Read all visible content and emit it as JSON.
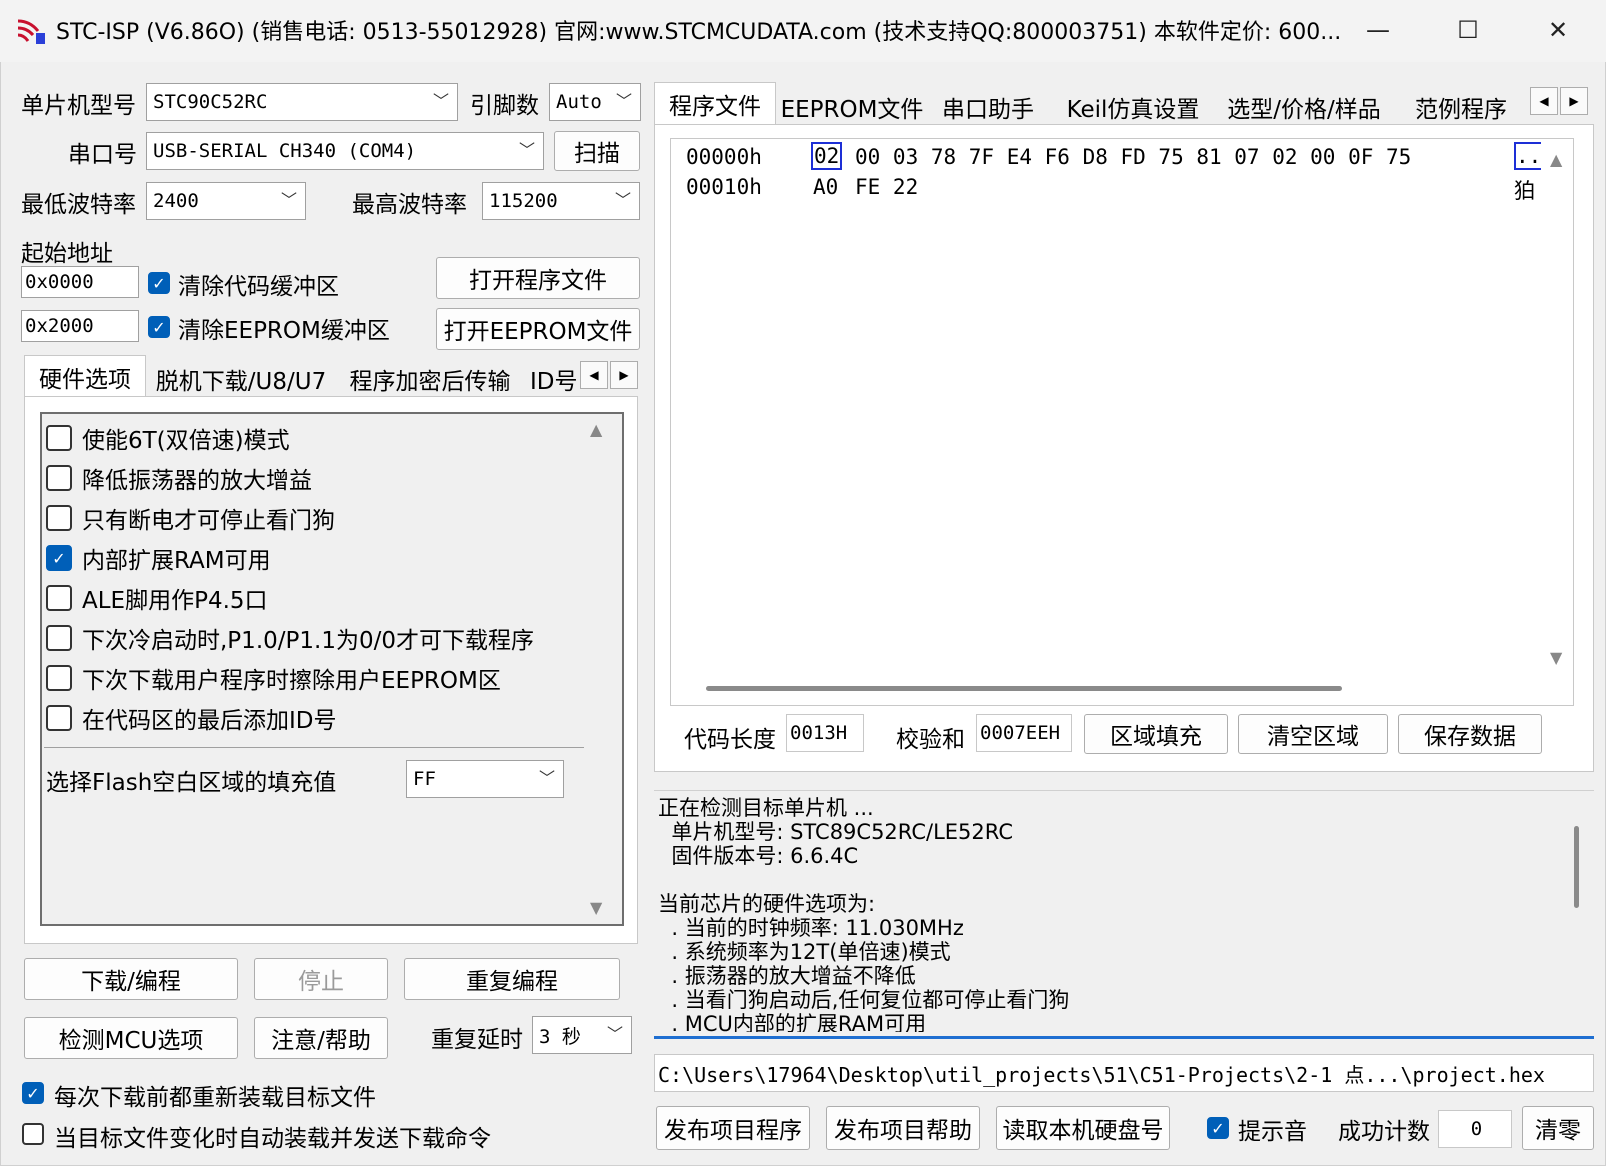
{
  "window": {
    "title": "STC-ISP (V6.86O) (销售电话: 0513-55012928) 官网:www.STCMCUDATA.com  (技术支持QQ:800003751) 本软件定价: 600...",
    "minimize": "—",
    "maximize": "☐",
    "close": "✕"
  },
  "mcu": {
    "model_label": "单片机型号",
    "model_value": "STC90C52RC",
    "pins_label": "引脚数",
    "pins_value": "Auto",
    "port_label": "串口号",
    "port_value": "USB-SERIAL CH340  (COM4)",
    "scan_label": "扫描",
    "min_baud_label": "最低波特率",
    "min_baud_value": "2400",
    "max_baud_label": "最高波特率",
    "max_baud_value": "115200"
  },
  "start_address": {
    "label": "起始地址",
    "code_addr": "0x0000",
    "clear_code_label": "清除代码缓冲区",
    "eeprom_addr": "0x2000",
    "clear_eeprom_label": "清除EEPROM缓冲区",
    "open_program_label": "打开程序文件",
    "open_eeprom_label": "打开EEPROM文件"
  },
  "left_tabs": [
    "硬件选项",
    "脱机下载/U8/U7",
    "程序加密后传输",
    "ID号"
  ],
  "hardware_options": [
    {
      "label": "使能6T(双倍速)模式",
      "checked": false
    },
    {
      "label": "降低振荡器的放大增益",
      "checked": false
    },
    {
      "label": "只有断电才可停止看门狗",
      "checked": false
    },
    {
      "label": "内部扩展RAM可用",
      "checked": true
    },
    {
      "label": "ALE脚用作P4.5口",
      "checked": false
    },
    {
      "label": "下次冷启动时,P1.0/P1.1为0/0才可下载程序",
      "checked": false
    },
    {
      "label": "下次下载用户程序时擦除用户EEPROM区",
      "checked": false
    },
    {
      "label": "在代码区的最后添加ID号",
      "checked": false
    }
  ],
  "fill_value": {
    "label": "选择Flash空白区域的填充值",
    "value": "FF"
  },
  "actions": {
    "download": "下载/编程",
    "stop": "停止",
    "reprogram": "重复编程",
    "detect": "检测MCU选项",
    "help": "注意/帮助",
    "repeat_delay_label": "重复延时",
    "repeat_delay_value": "3 秒",
    "reload_label": "每次下载前都重新装载目标文件",
    "auto_label": "当目标文件变化时自动装载并发送下载命令"
  },
  "right_tabs": [
    "程序文件",
    "EEPROM文件",
    "串口助手",
    "Keil仿真设置",
    "选型/价格/样品",
    "范例程序"
  ],
  "hex": {
    "rows": [
      {
        "addr": "00000h",
        "first": "02",
        "bytes": "00 03 78 7F E4 F6 D8 FD 75 81 07 02 00 0F 75",
        "ascii": ".."
      },
      {
        "addr": "00010h",
        "first": "A0",
        "bytes": "FE 22",
        "ascii": "狛"
      }
    ]
  },
  "code_info": {
    "length_label": "代码长度",
    "length_value": "0013H",
    "checksum_label": "校验和",
    "checksum_value": "0007EEH",
    "fill_btn": "区域填充",
    "clear_btn": "清空区域",
    "save_btn": "保存数据"
  },
  "log": [
    "正在检测目标单片机 ...",
    "  单片机型号: STC89C52RC/LE52RC",
    "  固件版本号: 6.6.4C",
    "",
    "当前芯片的硬件选项为:",
    "  . 当前的时钟频率: 11.030MHz",
    "  . 系统频率为12T(单倍速)模式",
    "  . 振荡器的放大增益不降低",
    "  . 当看门狗启动后,任何复位都可停止看门狗",
    "  . MCU内部的扩展RAM可用"
  ],
  "file_path": "C:\\Users\\17964\\Desktop\\util_projects\\51\\C51-Projects\\2-1 点...\\project.hex",
  "bottom": {
    "publish_program": "发布项目程序",
    "publish_help": "发布项目帮助",
    "read_disk": "读取本机硬盘号",
    "beep_label": "提示音",
    "success_label": "成功计数",
    "success_value": "0",
    "clear_label": "清零"
  }
}
